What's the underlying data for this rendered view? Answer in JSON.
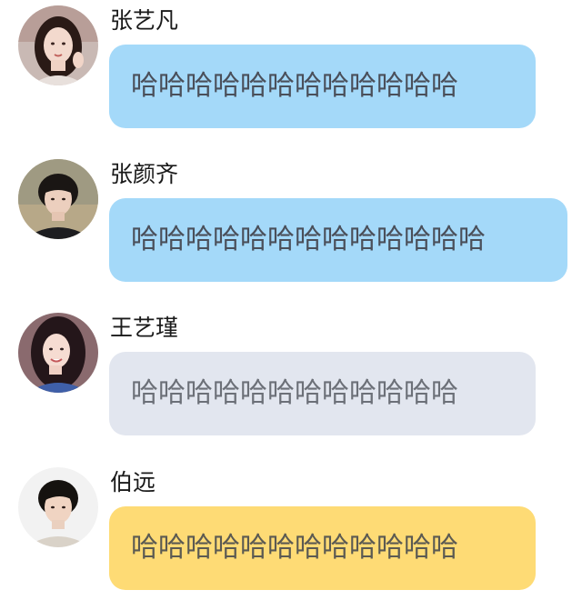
{
  "messages": [
    {
      "name": "张艺凡",
      "text": "哈哈哈哈哈哈哈哈哈哈哈哈",
      "bubble_color": "#a4d9f9",
      "avatar": "avatar-photo-woman"
    },
    {
      "name": "张颜齐",
      "text": "哈哈哈哈哈哈哈哈哈哈哈哈哈",
      "bubble_color": "#a4d9f9",
      "avatar": "avatar-photo-man"
    },
    {
      "name": "王艺瑾",
      "text": "哈哈哈哈哈哈哈哈哈哈哈哈",
      "bubble_color": "#e2e6ef",
      "avatar": "avatar-photo-woman"
    },
    {
      "name": "伯远",
      "text": "哈哈哈哈哈哈哈哈哈哈哈哈",
      "bubble_color": "#fedb75",
      "avatar": "avatar-photo-man"
    }
  ]
}
